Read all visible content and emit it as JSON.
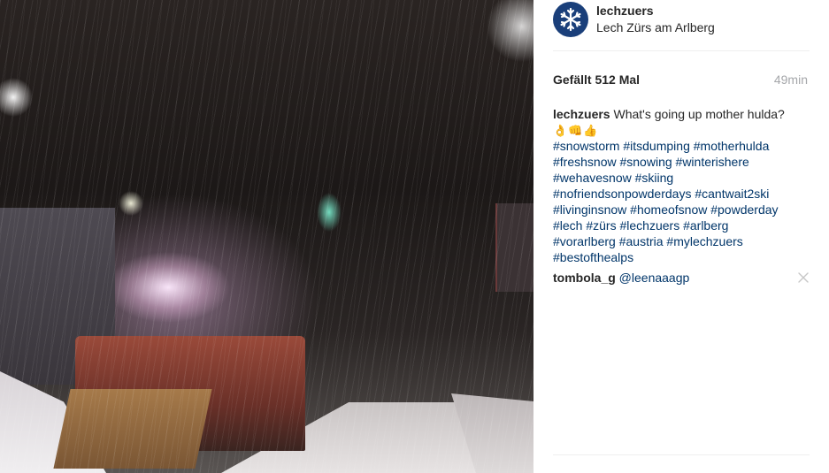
{
  "post": {
    "username": "lechzuers",
    "location": "Lech Zürs am Arlberg",
    "likes": "Gefällt 512 Mal",
    "time": "49min"
  },
  "caption": {
    "username": "lechzuers",
    "text": "What's going up mother hulda?",
    "emojis": [
      "👌",
      "👊",
      "👍"
    ],
    "hashtag_lines": [
      [
        "#snowstorm",
        "#itsdumping",
        "#motherhulda"
      ],
      [
        "#freshsnow",
        "#snowing",
        "#winterishere"
      ],
      [
        "#wehavesnow",
        "#skiing"
      ],
      [
        "#nofriendsonpowderdays",
        "#cantwait2ski"
      ],
      [
        "#livinginsnow",
        "#homeofsnow",
        "#powderday"
      ],
      [
        "#lech",
        "#zürs",
        "#lechzuers",
        "#arlberg"
      ],
      [
        "#vorarlberg",
        "#austria",
        "#mylechzuers"
      ],
      [
        "#bestofthealps"
      ]
    ]
  },
  "comment": {
    "username": "tombola_g",
    "mention": "@leenaaagp"
  },
  "icons": {
    "avatar": "snowflake-logo-icon",
    "delete": "close-icon"
  },
  "colors": {
    "hashtag": "#003569",
    "muted": "#a5a7aa",
    "avatar_bg": "#1a3f7a"
  }
}
